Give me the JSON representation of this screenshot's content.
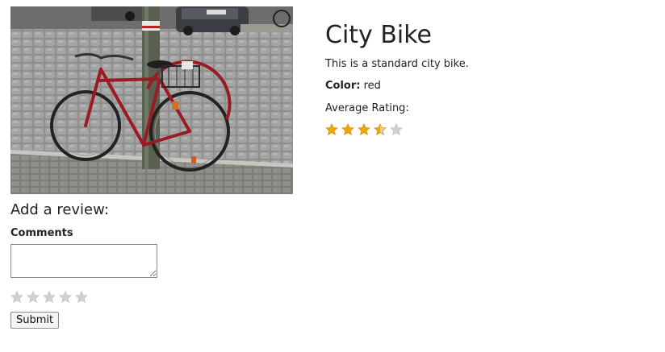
{
  "product": {
    "image_alt": "Red city bike leaning against a pole on a cobblestone street",
    "title": "City Bike",
    "description": "This is a standard city bike.",
    "color_label": "Color:",
    "color_value": "red",
    "average_rating_label": "Average Rating:",
    "average_rating": 3.5,
    "max_rating": 5,
    "star_color_filled": "#f0a500",
    "star_color_empty": "#d0d0d0"
  },
  "review_form": {
    "heading": "Add a review:",
    "comments_label": "Comments",
    "comments_value": "",
    "rating_value": 0,
    "max_rating": 5,
    "submit_label": "Submit"
  }
}
